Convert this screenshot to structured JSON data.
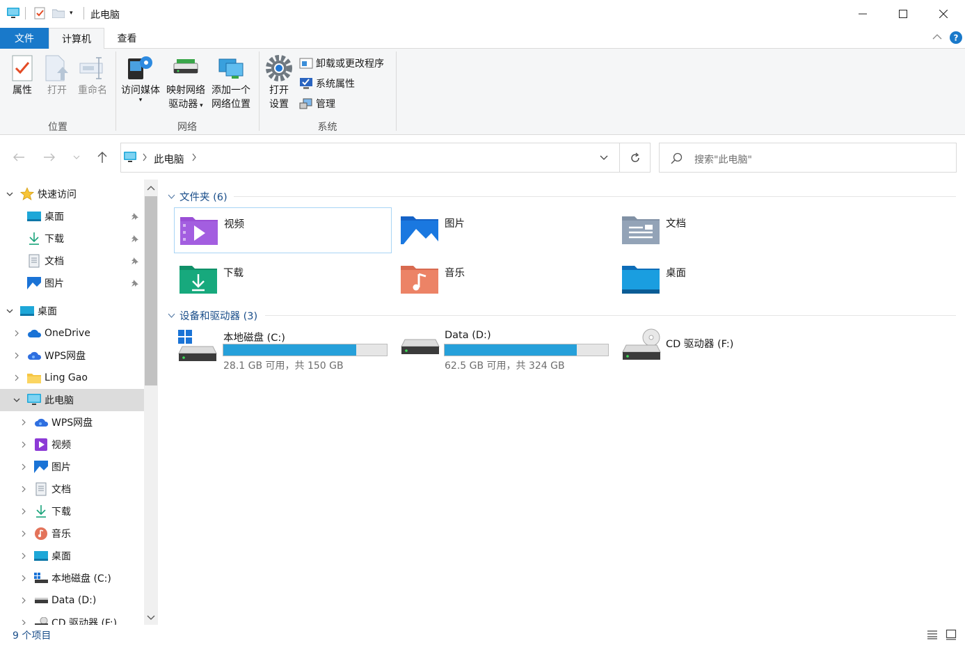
{
  "window": {
    "title": "此电脑",
    "controls": [
      "minimize-icon",
      "maximize-icon",
      "close-icon"
    ]
  },
  "ribbon": {
    "tabs": [
      "文件",
      "计算机",
      "查看"
    ],
    "active_tab": "计算机",
    "groups": [
      {
        "label": "位置",
        "buttons": [
          "属性",
          "打开",
          "重命名"
        ]
      },
      {
        "label": "网络",
        "buttons": [
          "访问媒体",
          "映射网络",
          "驱动器",
          "添加一个",
          "网络位置"
        ]
      },
      {
        "label": "系统",
        "buttons": [
          "打开",
          "设置"
        ],
        "small_buttons": [
          "卸载或更改程序",
          "系统属性",
          "管理"
        ]
      }
    ]
  },
  "address": {
    "path": [
      "此电脑"
    ],
    "search_placeholder": "搜索\"此电脑\""
  },
  "nav": {
    "quick_access": "快速访问",
    "quick_items": [
      "桌面",
      "下载",
      "文档",
      "图片"
    ],
    "desktop": "桌面",
    "desktop_children": [
      "OneDrive",
      "WPS网盘",
      "Ling Gao",
      "此电脑"
    ],
    "pc_children": [
      "WPS网盘",
      "视频",
      "图片",
      "文档",
      "下载",
      "音乐",
      "桌面",
      "本地磁盘 (C:)",
      "Data (D:)",
      "CD 驱动器 (F:)"
    ]
  },
  "content": {
    "folders_header": "文件夹 (6)",
    "folders": [
      "视频",
      "图片",
      "文档",
      "下载",
      "音乐",
      "桌面"
    ],
    "drives_header": "设备和驱动器 (3)",
    "drives": [
      {
        "name": "本地磁盘 (C:)",
        "info": "28.1 GB 可用，共 150 GB",
        "used_fraction": 0.813
      },
      {
        "name": "Data (D:)",
        "info": "62.5 GB 可用，共 324 GB",
        "used_fraction": 0.807
      },
      {
        "name": "CD 驱动器 (F:)"
      }
    ]
  },
  "status": {
    "count": "9 个项目"
  },
  "colors": {
    "accent": "#1979ca",
    "drive_fill": "#26a0da",
    "selected_nav": "#dcdcdc"
  }
}
